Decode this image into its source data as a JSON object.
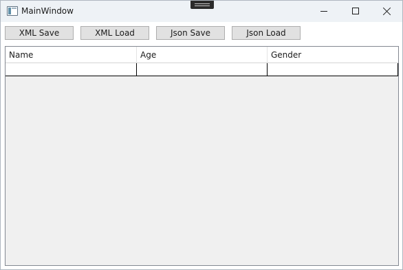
{
  "window": {
    "title": "MainWindow",
    "icon": "app-window-icon"
  },
  "caption_buttons": {
    "minimize_icon": "minimize-icon",
    "maximize_icon": "maximize-icon",
    "close_icon": "close-icon"
  },
  "toolbar": {
    "xml_save_label": "XML Save",
    "xml_load_label": "XML Load",
    "json_save_label": "Json Save",
    "json_load_label": "Json Load"
  },
  "grid": {
    "columns": [
      "Name",
      "Age",
      "Gender"
    ],
    "rows": [
      {
        "name": "",
        "age": "",
        "gender": ""
      }
    ]
  }
}
